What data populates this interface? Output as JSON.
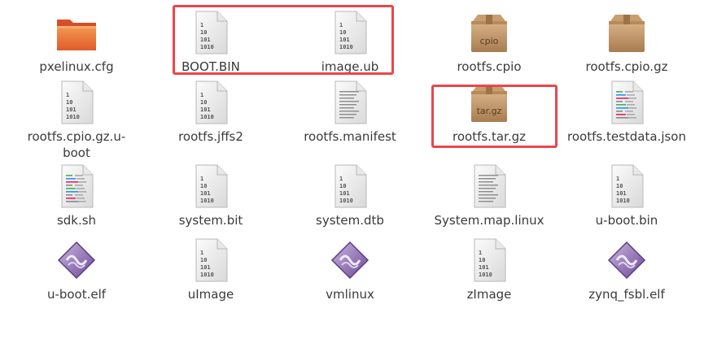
{
  "files": [
    {
      "name": "pxelinux.cfg",
      "icon": "folder-icon"
    },
    {
      "name": "BOOT.BIN",
      "icon": "binary-file-icon"
    },
    {
      "name": "image.ub",
      "icon": "binary-file-icon"
    },
    {
      "name": "rootfs.cpio",
      "icon": "archive-icon",
      "icon_text": "cpio"
    },
    {
      "name": "rootfs.cpio.gz",
      "icon": "archive-icon",
      "icon_text": ""
    },
    {
      "name": "rootfs.cpio.gz.u-boot",
      "icon": "binary-file-icon"
    },
    {
      "name": "rootfs.jffs2",
      "icon": "binary-file-icon"
    },
    {
      "name": "rootfs.manifest",
      "icon": "text-file-icon"
    },
    {
      "name": "rootfs.tar.gz",
      "icon": "archive-icon",
      "icon_text": "tar.gz"
    },
    {
      "name": "rootfs.testdata.json",
      "icon": "script-file-icon"
    },
    {
      "name": "sdk.sh",
      "icon": "script-file-icon"
    },
    {
      "name": "system.bit",
      "icon": "binary-file-icon"
    },
    {
      "name": "system.dtb",
      "icon": "binary-file-icon"
    },
    {
      "name": "System.map.linux",
      "icon": "text-file-icon"
    },
    {
      "name": "u-boot.bin",
      "icon": "binary-file-icon"
    },
    {
      "name": "u-boot.elf",
      "icon": "executable-icon"
    },
    {
      "name": "uImage",
      "icon": "binary-file-icon"
    },
    {
      "name": "vmlinux",
      "icon": "executable-icon"
    },
    {
      "name": "zImage",
      "icon": "binary-file-icon"
    },
    {
      "name": "zynq_fsbl.elf",
      "icon": "executable-icon"
    }
  ],
  "binary_icon_lines": [
    "1",
    "10",
    "101",
    "1010"
  ],
  "colors": {
    "highlight": "#e8474b",
    "folder": "#e8652a",
    "archive": "#c49a6c",
    "executable": "#8a6ab0"
  }
}
